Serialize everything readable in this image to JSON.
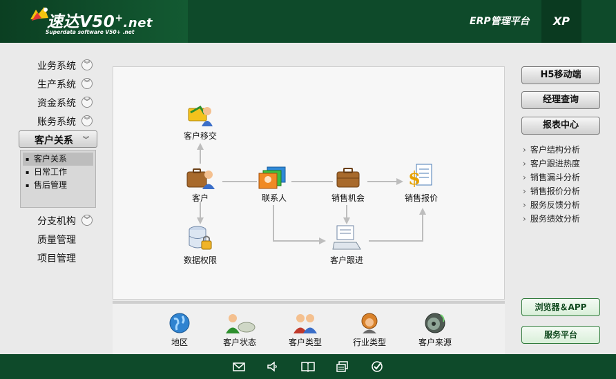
{
  "header": {
    "logo_title": "速达V50",
    "logo_plus": "+",
    "logo_suffix": ".net",
    "logo_subtitle": "Superdata software V50+ .net",
    "platform": "ERP管理平台",
    "edition": "XP"
  },
  "left_menu": {
    "items": [
      {
        "label": "业务系统",
        "expandable": true
      },
      {
        "label": "生产系统",
        "expandable": true
      },
      {
        "label": "资金系统",
        "expandable": true
      },
      {
        "label": "账务系统",
        "expandable": true
      }
    ],
    "active": {
      "label": "客户关系"
    },
    "submenu": [
      "客户关系",
      "日常工作",
      "售后管理"
    ],
    "items_after": [
      {
        "label": "分支机构",
        "expandable": true
      },
      {
        "label": "质量管理",
        "expandable": false
      },
      {
        "label": "项目管理",
        "expandable": false
      }
    ]
  },
  "flow": {
    "transfer": "客户移交",
    "customer": "客户",
    "contact": "联系人",
    "opportunity": "销售机会",
    "quote": "销售报价",
    "data_perm": "数据权限",
    "followup": "客户跟进"
  },
  "bottom": [
    "地区",
    "客户状态",
    "客户类型",
    "行业类型",
    "客户来源"
  ],
  "right": {
    "buttons": [
      "H5移动端",
      "经理查询",
      "报表中心"
    ],
    "links": [
      "客户结构分析",
      "客户跟进热度",
      "销售漏斗分析",
      "销售报价分析",
      "服务反馈分析",
      "服务绩效分析"
    ],
    "green_buttons": [
      "浏览器＆APP",
      "服务平台"
    ]
  },
  "footer_icons": [
    "mail-icon",
    "speaker-icon",
    "book-icon",
    "window-icon",
    "check-icon"
  ]
}
